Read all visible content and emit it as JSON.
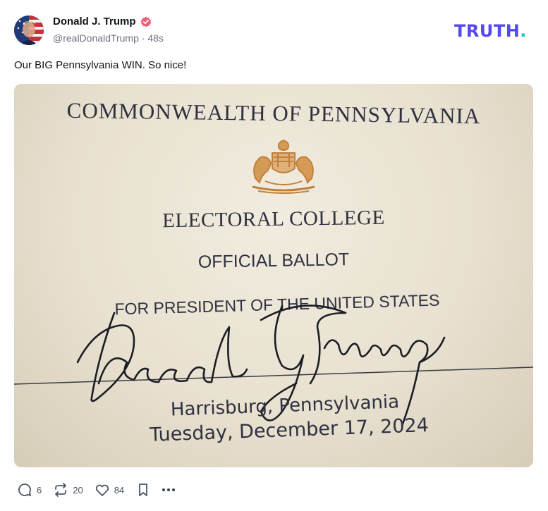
{
  "author": {
    "display_name": "Donald J. Trump",
    "handle": "@realDonaldTrump",
    "separator": "·",
    "time_ago": "48s"
  },
  "brand": {
    "name": "TRUTH",
    "dot": "."
  },
  "post": {
    "text": "Our BIG Pennsylvania WIN. So nice!"
  },
  "image": {
    "lines": {
      "commonwealth": "COMMONWEALTH OF PENNSYLVANIA",
      "electoral": "ELECTORAL COLLEGE",
      "ballot": "OFFICIAL BALLOT",
      "for_president": "FOR PRESIDENT OF THE UNITED STATES",
      "city": "Harrisburg, Pennsylvania",
      "date": "Tuesday, December 17, 2024"
    },
    "signature_text": "Donald J. Trump"
  },
  "actions": {
    "replies": "6",
    "retruths": "20",
    "likes": "84"
  },
  "colors": {
    "brand": "#5448ee",
    "brand_dot": "#15c8b7",
    "verified_badge": "#f15e7a",
    "seal_gold": "#c0813d"
  }
}
